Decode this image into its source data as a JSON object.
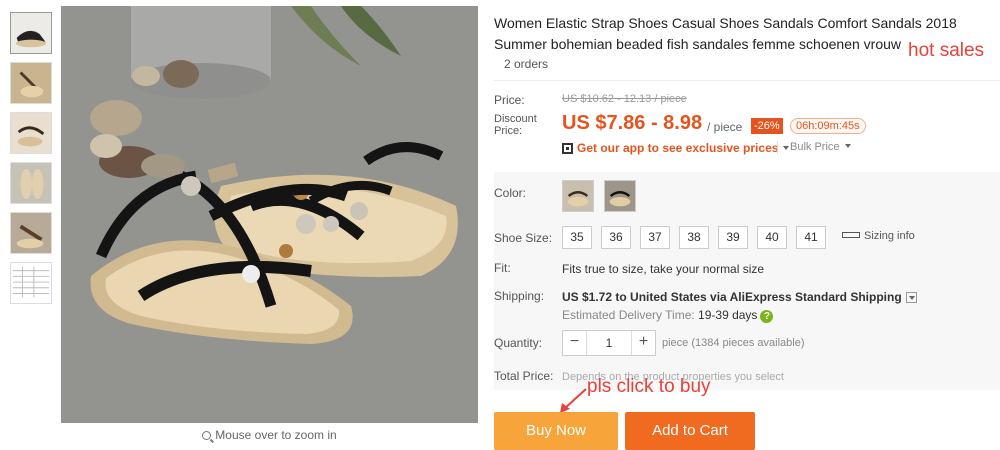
{
  "gallery": {
    "thumbnails": [
      "sandal-thumb-1",
      "sandal-thumb-2",
      "sandal-thumb-3",
      "sandal-thumb-4",
      "sandal-thumb-5",
      "size-chart-thumb"
    ],
    "zoom_hint": "Mouse over to zoom in"
  },
  "product": {
    "title": "Women Elastic Strap Shoes Casual Shoes Sandals Comfort Sandals 2018 Summer bohemian beaded fish sandales femme schoenen vrouw",
    "hot_label": "hot sales",
    "orders": "2 orders"
  },
  "price": {
    "label": "Price:",
    "original": "US $10.62 - 12.13 / piece",
    "discount_label": "Discount Price:",
    "discount_value": "US $7.86 - 8.98",
    "unit": "/ piece",
    "off_badge": "-26%",
    "timer": "06h:09m:45s",
    "app_promo": "Get our app to see exclusive prices",
    "bulk": "Bulk Price"
  },
  "props": {
    "color_label": "Color:",
    "size_label": "Shoe Size:",
    "sizes": [
      "35",
      "36",
      "37",
      "38",
      "39",
      "40",
      "41"
    ],
    "sizing_info": "Sizing info",
    "fit_label": "Fit:",
    "fit_value": "Fits true to size, take your normal size",
    "shipping_label": "Shipping:",
    "shipping_value": "US $1.72 to United States via AliExpress Standard Shipping",
    "delivery_label": "Estimated Delivery Time:",
    "delivery_value": "19-39 days",
    "quantity_label": "Quantity:",
    "quantity_value": "1",
    "available": "piece (1384 pieces available)",
    "total_label": "Total Price:",
    "total_value": "Depends on the product properties you select"
  },
  "annotation": {
    "pls_click": "pls click to buy"
  },
  "actions": {
    "buy_now": "Buy Now",
    "add_to_cart": "Add to Cart"
  },
  "colors": {
    "discount": "#e5541d",
    "buy_now": "#f7a43b",
    "add_to_cart": "#f06a1f",
    "annotation": "#e8413a"
  }
}
